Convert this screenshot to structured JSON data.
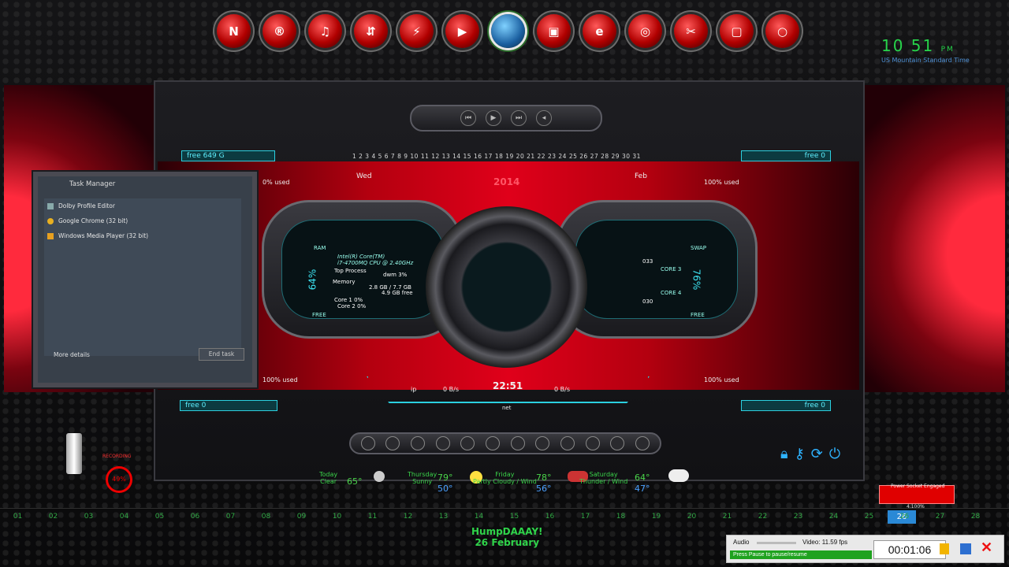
{
  "dock": {
    "icons": [
      "nvidia-icon",
      "registered-icon",
      "headphones-icon",
      "usb-icon",
      "flash-icon",
      "play-icon",
      "globe-icon",
      "tv-icon",
      "ie-icon",
      "chrome-icon",
      "tools-icon",
      "window-icon",
      "ring-icon"
    ],
    "glyphs": [
      "N",
      "®",
      "♫",
      "⇵",
      "⚡",
      "▶",
      "",
      "▣",
      "e",
      "◎",
      "✂",
      "▢",
      "○"
    ]
  },
  "clock": {
    "time": "10 51",
    "ampm": "PM",
    "timezone": "US Mountain Standard Time"
  },
  "dashboard": {
    "free_top_left": "free 649 G",
    "used_top_left": "0% used",
    "free_top_right": "free 0",
    "used_top_right": "100% used",
    "day": "Wed",
    "month": "Feb",
    "year": "2014",
    "date_strip": "1 2 3 4 5 6 7 8 9 10 11 12 13 14 15 16 17 18 19 20 21 22 23 24 25 26 27 28 29 30 31",
    "ram_pct": "64%",
    "swap_pct": "76%",
    "ram_label": "RAM",
    "swap_label": "SWAP",
    "free_label": "FREE",
    "cpu_name": "Intel(R) Core(TM)",
    "cpu_model": "i7-4700MQ CPU @ 2.40GHz",
    "top_process_label": "Top Process",
    "top_process": "dwm  3%",
    "memory_label": "Memory",
    "memory_1": "2.8 GB / 7.7 GB",
    "memory_2": "4.9 GB free",
    "core1": "Core 1  0%",
    "core2": "Core 2  0%",
    "val_033": "033",
    "val_030": "030",
    "core3": "CORE 3",
    "core4": "CORE 4",
    "used_bottom_left": "100% used",
    "free_bottom_left": "free 0",
    "used_bottom_right": "100% used",
    "free_bottom_right": "free 0",
    "net_time": "22:51",
    "net_in": "0 B/s",
    "net_out": "0 B/s",
    "net_label": "net",
    "ip_label": "ip"
  },
  "task_manager": {
    "title": "Task Manager",
    "items": [
      "Dolby Profile Editor",
      "Google Chrome (32 bit)",
      "Windows Media Player (32 bit)"
    ],
    "more_details": "More details",
    "end_task": "End task"
  },
  "weather": {
    "today": {
      "label": "Today",
      "cond": "Clear",
      "temp": "65°"
    },
    "thursday": {
      "label": "Thursday",
      "cond": "Sunny",
      "high": "79°",
      "low": "50°"
    },
    "friday": {
      "label": "Friday",
      "cond": "Partly Cloudy / Wind",
      "high": "78°",
      "low": "56°"
    },
    "saturday": {
      "label": "Saturday",
      "cond": "Thunder / Wind",
      "high": "64°",
      "low": "47°"
    }
  },
  "days_strip": [
    "01",
    "02",
    "03",
    "04",
    "05",
    "06",
    "07",
    "08",
    "09",
    "10",
    "11",
    "12",
    "13",
    "14",
    "15",
    "16",
    "17",
    "18",
    "19",
    "20",
    "21",
    "22",
    "23",
    "24",
    "25",
    "26",
    "27",
    "28"
  ],
  "greeting": {
    "line1": "HumpDAAAY!",
    "line2": "26 February"
  },
  "recorder_widget": {
    "percent_label": "49%",
    "caption": "RECORDING"
  },
  "power": {
    "label": "Power Socket Engaged",
    "percent": "4.100%",
    "day": "26"
  },
  "recorder": {
    "audio": "Audio",
    "video": "Video: 11.59 fps",
    "time": "00:01:06",
    "hint": "Press Pause to pause/resume"
  },
  "colors": {
    "accent_red": "#e0001a",
    "accent_cyan": "#3ee6f5",
    "clock_green": "#27d44b"
  }
}
